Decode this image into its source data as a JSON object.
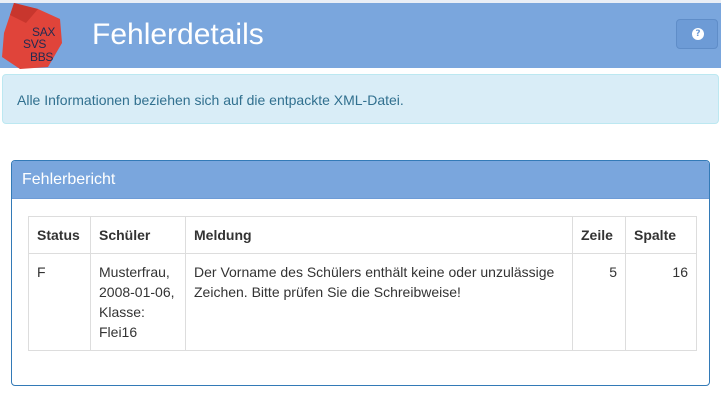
{
  "header": {
    "logo_lines": [
      "SAX",
      "SVS",
      "BBS"
    ],
    "title": "Fehlerdetails",
    "help_icon": "question-circle-icon",
    "background_color": "#7aa6dd"
  },
  "alert": {
    "text": "Alle Informationen beziehen sich auf die entpackte XML-Datei.",
    "color": "#31708f",
    "background_color": "#d9edf7"
  },
  "panel": {
    "title": "Fehlerbericht",
    "table": {
      "headers": {
        "status": "Status",
        "schueler": "Schüler",
        "meldung": "Meldung",
        "zeile": "Zeile",
        "spalte": "Spalte"
      },
      "rows": [
        {
          "status": "F",
          "schueler_lines": [
            "Musterfrau,",
            "2008-01-06,",
            "Klasse:",
            "Flei16"
          ],
          "meldung": "Der Vorname des Schülers enthält keine oder unzulässige Zeichen. Bitte prüfen Sie die Schreibweise!",
          "zeile": "5",
          "spalte": "16"
        }
      ]
    }
  }
}
